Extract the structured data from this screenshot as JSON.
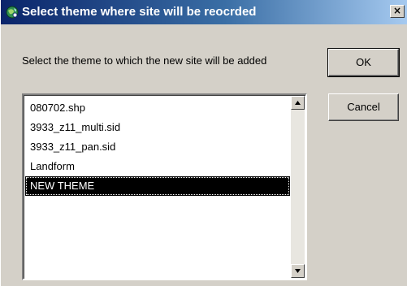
{
  "window": {
    "title": "Select theme where site will be reocrded",
    "close_glyph": "×",
    "icon": "globe-icon"
  },
  "prompt": "Select the theme to which the new site will be added",
  "buttons": {
    "ok_label": "OK",
    "cancel_label": "Cancel"
  },
  "theme_list": {
    "items": [
      {
        "label": "080702.shp",
        "selected": false
      },
      {
        "label": "3933_z11_multi.sid",
        "selected": false
      },
      {
        "label": "3933_z11_pan.sid",
        "selected": false
      },
      {
        "label": "Landform",
        "selected": false
      },
      {
        "label": "NEW THEME",
        "selected": true
      }
    ]
  },
  "colors": {
    "titlebar_start": "#0a246a",
    "titlebar_end": "#a6caf0",
    "face": "#d4d0c8",
    "selection": "#000000"
  }
}
